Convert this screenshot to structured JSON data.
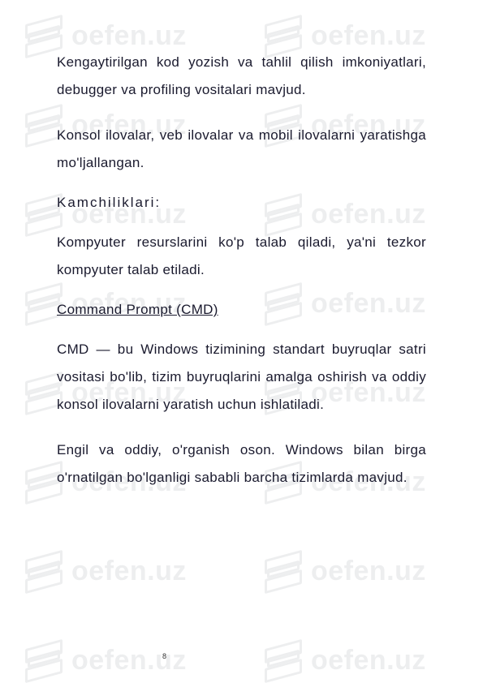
{
  "watermark": "oefen.uz",
  "paragraphs": {
    "p1": "Kengaytirilgan kod yozish va tahlil qilish imkoniyatlari, debugger va profiling vositalari mavjud.",
    "p2": "Konsol ilovalar, veb ilovalar va mobil ilovalarni yaratishga mo'ljallangan.",
    "heading1": "Kamchiliklari:",
    "p3": "Kompyuter resurslarini ko'p talab qiladi, ya'ni tezkor kompyuter talab etiladi.",
    "subheading1": "Command Prompt (CMD)",
    "p4": "CMD — bu Windows tizimining standart buyruqlar satri vositasi bo'lib, tizim buyruqlarini amalga oshirish va oddiy konsol ilovalarni yaratish uchun ishlatiladi.",
    "p5": "Engil va oddiy, o'rganish oson. Windows bilan birga o'rnatilgan bo'lganligi sababli barcha tizimlarda mavjud."
  },
  "pageNumber": "8"
}
